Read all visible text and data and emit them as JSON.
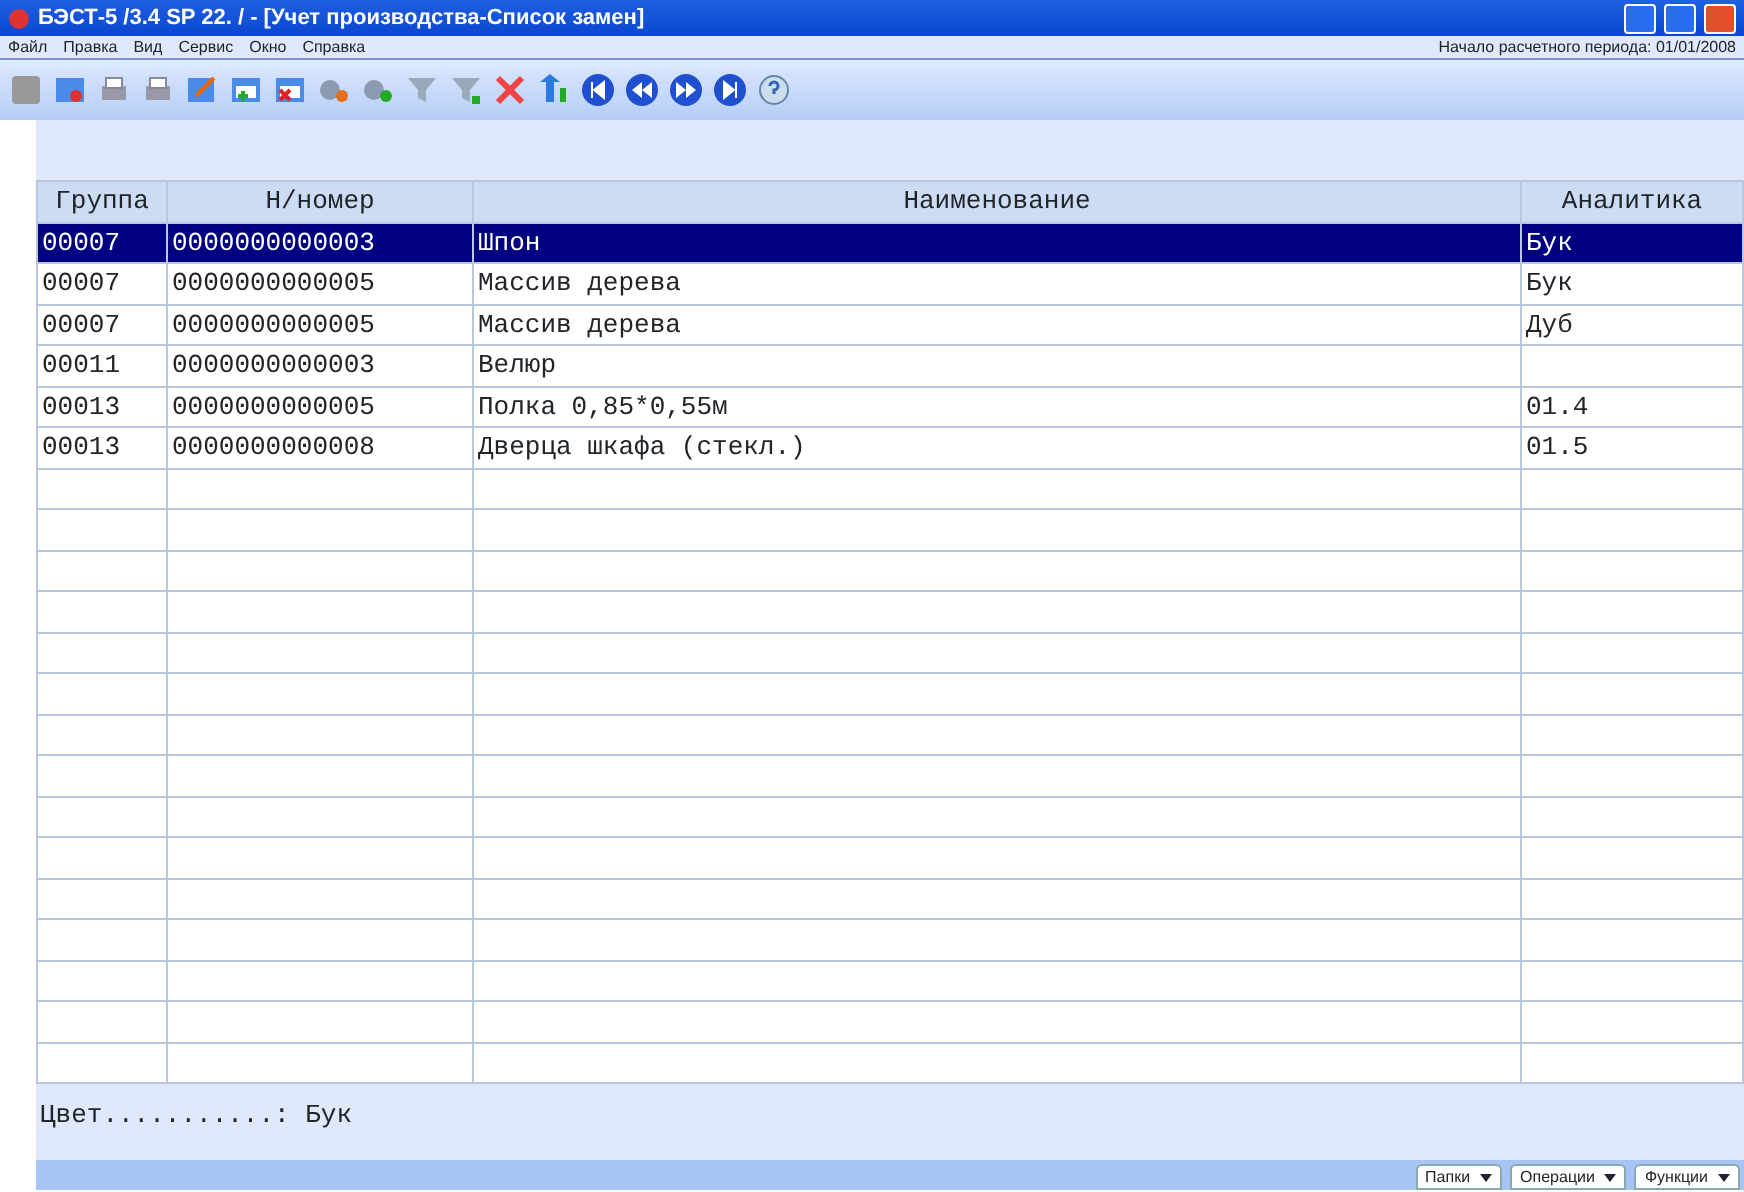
{
  "window": {
    "title": "БЭСТ-5 /3.4 SP 22. / - [Учет производства-Список замен]"
  },
  "menu": [
    "Файл",
    "Правка",
    "Вид",
    "Сервис",
    "Окно",
    "Справка"
  ],
  "period": "Начало расчетного периода: 01/01/2008",
  "table": {
    "columns": [
      "Группа",
      "Н/номер",
      "Наименование",
      "Аналитика"
    ],
    "rows": [
      {
        "cells": [
          "00007",
          "0000000000003",
          "Шпон",
          "Бук"
        ],
        "selected": true
      },
      {
        "cells": [
          "00007",
          "0000000000005",
          "Массив дерева",
          "Бук"
        ],
        "selected": false
      },
      {
        "cells": [
          "00007",
          "0000000000005",
          "Массив дерева",
          "Дуб"
        ],
        "selected": false
      },
      {
        "cells": [
          "00011",
          "0000000000003",
          "Велюр",
          ""
        ],
        "selected": false
      },
      {
        "cells": [
          "00013",
          "0000000000005",
          "Полка 0,85*0,55м",
          "01.4"
        ],
        "selected": false
      },
      {
        "cells": [
          "00013",
          "0000000000008",
          "Дверца шкафа (стекл.)",
          "01.5"
        ],
        "selected": false
      }
    ]
  },
  "detail": "Цвет...........: Бук",
  "bottom_buttons": [
    "Папки",
    "Операции",
    "Функции"
  ]
}
